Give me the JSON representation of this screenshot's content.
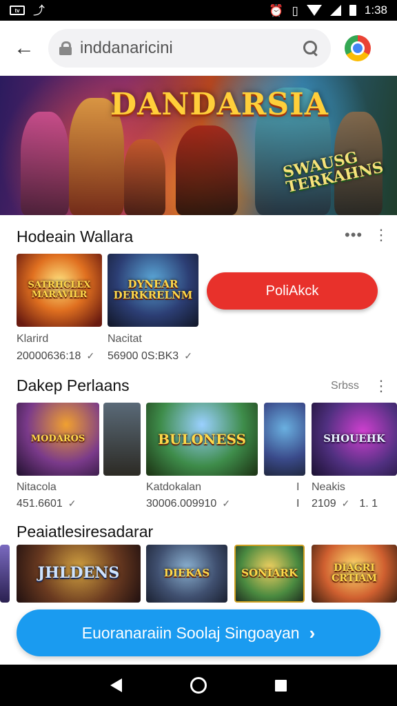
{
  "status_bar": {
    "time": "1:38",
    "left_icons": [
      "app-icon",
      "share-icon"
    ],
    "right_icons": [
      "alarm-icon",
      "vibrate-icon",
      "wifi-icon",
      "cell-icon",
      "battery-icon"
    ]
  },
  "header": {
    "search_text": "inddanaricini",
    "icons": [
      "back-arrow-icon",
      "lock-icon",
      "search-icon",
      "chrome-icon"
    ]
  },
  "banner": {
    "title": "DANDARSIA",
    "badge": "SWAUSG TERKAHNS"
  },
  "section1": {
    "title": "Hodeain Wallara",
    "cards": [
      {
        "tile_text": "SATRHCLEX MARAVILR",
        "name": "Klarird",
        "count": "20000636:18"
      },
      {
        "tile_text": "DYNEAR DERKRELNM",
        "name": "Nacitat",
        "count": "56900 0S:BK3"
      }
    ],
    "cta": "PoliAkck"
  },
  "section2": {
    "title": "Dakep Perlaans",
    "more": "Srbss",
    "cards": [
      {
        "tile_text": "MODAROS",
        "name": "Nitacola",
        "count": "451.6601"
      },
      {
        "tile_text": "",
        "name": "",
        "count": ""
      },
      {
        "tile_text": "BULONESS",
        "name": "Katdokalan",
        "count": "30006.009910"
      },
      {
        "tile_text": "",
        "name": "I",
        "count": "I"
      },
      {
        "tile_text": "SHOUEHK",
        "name": "Neakis",
        "count": "2109"
      }
    ],
    "extra_count": "1. 1"
  },
  "section3": {
    "title": "Peaiatlesiresadarar",
    "tiles": [
      "JHLDENS",
      "DIEKAS",
      "SONIARK",
      "DIAGRI CRTIAM"
    ]
  },
  "bottom_cta": "Euoranaraiin Soolaj Singoayan",
  "colors": {
    "red_cta": "#e8312b",
    "blue_cta": "#1a9bf0"
  }
}
